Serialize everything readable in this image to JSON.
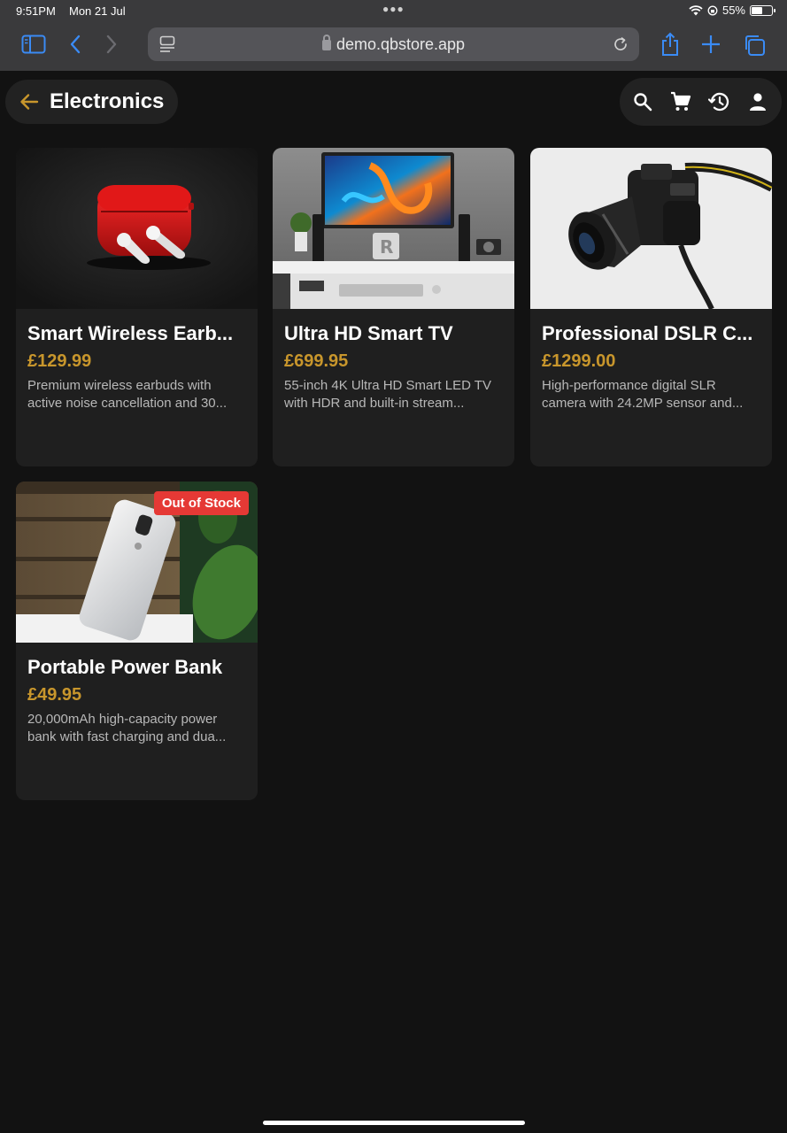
{
  "status": {
    "time": "9:51PM",
    "date": "Mon 21 Jul",
    "battery": "55%",
    "battery_level": 0.55
  },
  "browser": {
    "url": "demo.qbstore.app"
  },
  "header": {
    "title": "Electronics"
  },
  "products": [
    {
      "name": "Smart Wireless Earb...",
      "price": "£129.99",
      "description": "Premium wireless earbuds with active noise cancellation and 30..."
    },
    {
      "name": "Ultra HD Smart TV",
      "price": "£699.95",
      "description": "55-inch 4K Ultra HD Smart LED TV with HDR and built-in stream..."
    },
    {
      "name": "Professional DSLR C...",
      "price": "£1299.00",
      "description": "High-performance digital SLR camera with 24.2MP sensor and..."
    },
    {
      "name": "Portable Power Bank",
      "price": "£49.95",
      "description": "20,000mAh high-capacity power bank with fast charging and dua...",
      "badge": "Out of Stock"
    }
  ],
  "colors": {
    "accent": "#c8962c",
    "badge": "#e53935",
    "background": "#121212",
    "card": "#1f1f1f",
    "safari_blue": "#3a8bf5"
  }
}
